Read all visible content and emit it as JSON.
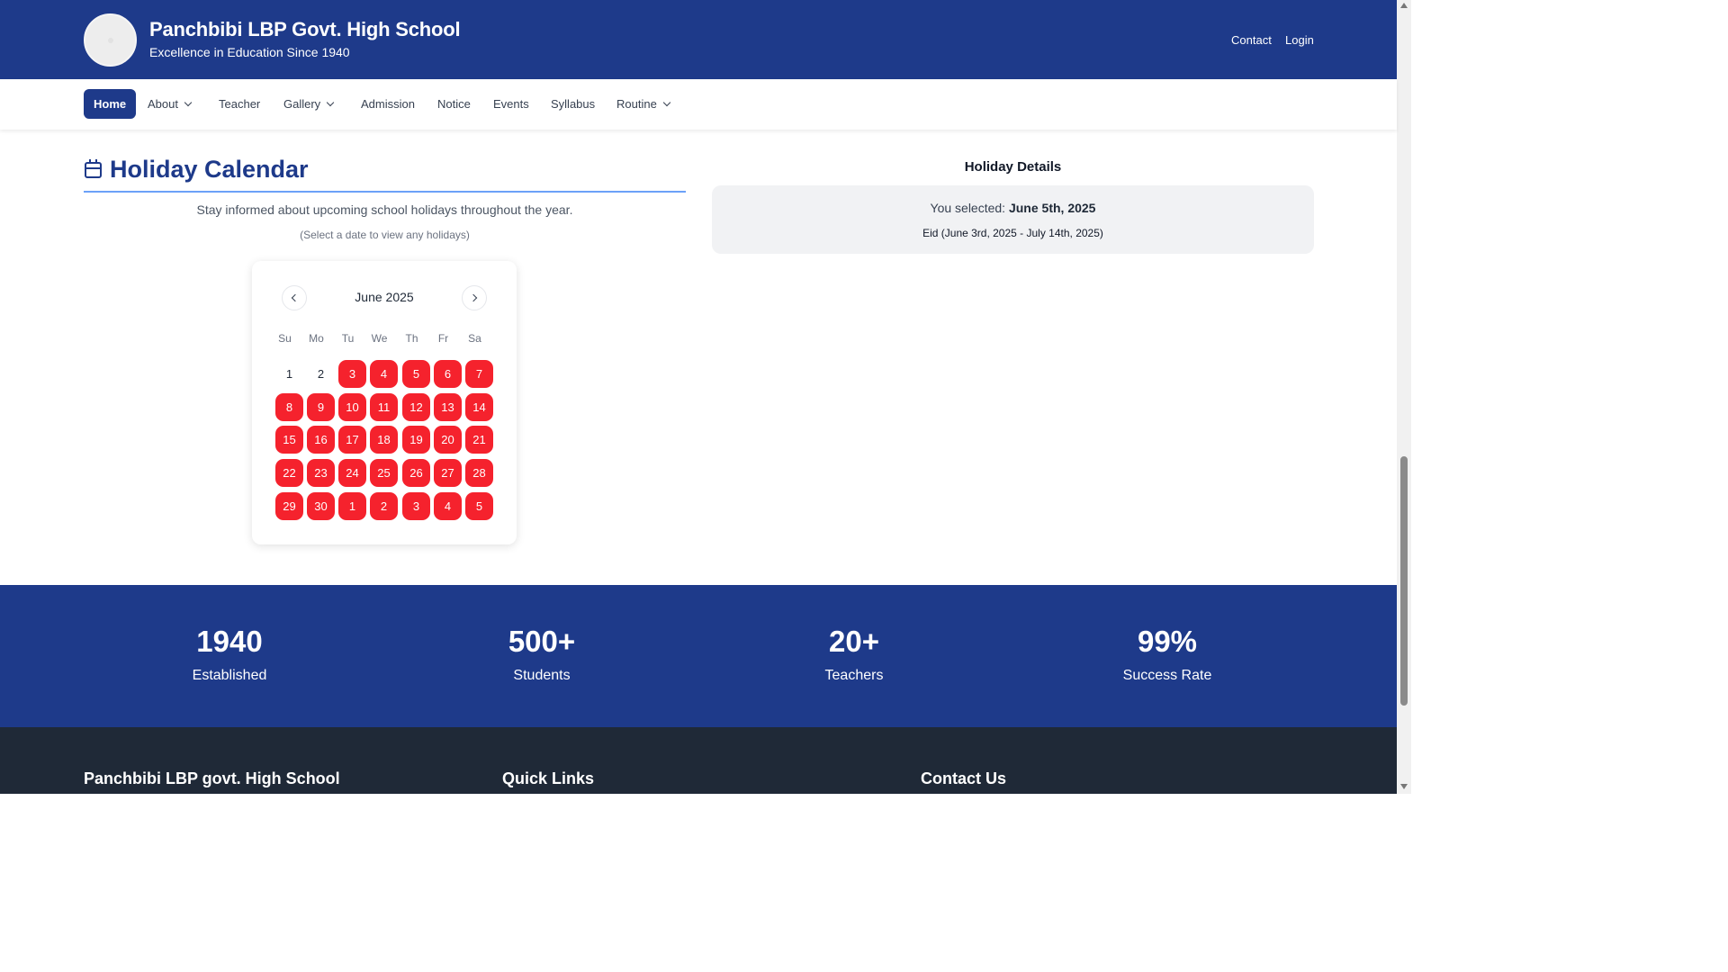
{
  "header": {
    "school_name": "Panchbibi LBP Govt. High School",
    "tagline": "Excellence in Education Since 1940",
    "links": {
      "contact": "Contact",
      "login": "Login"
    }
  },
  "nav": {
    "items": [
      {
        "label": "Home",
        "active": true,
        "dropdown": false
      },
      {
        "label": "About",
        "active": false,
        "dropdown": true
      },
      {
        "label": "Teacher",
        "active": false,
        "dropdown": false
      },
      {
        "label": "Gallery",
        "active": false,
        "dropdown": true
      },
      {
        "label": "Admission",
        "active": false,
        "dropdown": false
      },
      {
        "label": "Notice",
        "active": false,
        "dropdown": false
      },
      {
        "label": "Events",
        "active": false,
        "dropdown": false
      },
      {
        "label": "Syllabus",
        "active": false,
        "dropdown": false
      },
      {
        "label": "Routine",
        "active": false,
        "dropdown": true
      }
    ]
  },
  "calendar_section": {
    "title": "Holiday Calendar",
    "subtitle": "Stay informed about upcoming school holidays throughout the year.",
    "hint": "(Select a date to view any holidays)",
    "month_label": "June 2025",
    "weekdays": [
      "Su",
      "Mo",
      "Tu",
      "We",
      "Th",
      "Fr",
      "Sa"
    ],
    "weeks": [
      [
        {
          "d": "1",
          "h": false
        },
        {
          "d": "2",
          "h": false
        },
        {
          "d": "3",
          "h": true
        },
        {
          "d": "4",
          "h": true
        },
        {
          "d": "5",
          "h": true
        },
        {
          "d": "6",
          "h": true
        },
        {
          "d": "7",
          "h": true
        }
      ],
      [
        {
          "d": "8",
          "h": true
        },
        {
          "d": "9",
          "h": true
        },
        {
          "d": "10",
          "h": true
        },
        {
          "d": "11",
          "h": true
        },
        {
          "d": "12",
          "h": true
        },
        {
          "d": "13",
          "h": true
        },
        {
          "d": "14",
          "h": true
        }
      ],
      [
        {
          "d": "15",
          "h": true
        },
        {
          "d": "16",
          "h": true
        },
        {
          "d": "17",
          "h": true
        },
        {
          "d": "18",
          "h": true
        },
        {
          "d": "19",
          "h": true
        },
        {
          "d": "20",
          "h": true
        },
        {
          "d": "21",
          "h": true
        }
      ],
      [
        {
          "d": "22",
          "h": true
        },
        {
          "d": "23",
          "h": true
        },
        {
          "d": "24",
          "h": true
        },
        {
          "d": "25",
          "h": true
        },
        {
          "d": "26",
          "h": true
        },
        {
          "d": "27",
          "h": true
        },
        {
          "d": "28",
          "h": true
        }
      ],
      [
        {
          "d": "29",
          "h": true
        },
        {
          "d": "30",
          "h": true
        },
        {
          "d": "1",
          "h": true
        },
        {
          "d": "2",
          "h": true
        },
        {
          "d": "3",
          "h": true
        },
        {
          "d": "4",
          "h": true
        },
        {
          "d": "5",
          "h": true
        }
      ]
    ],
    "holiday_color": "#f5222d"
  },
  "details": {
    "title": "Holiday Details",
    "selected_prefix": "You selected: ",
    "selected_date": "June 5th, 2025",
    "holiday_text": "Eid (June 3rd, 2025 - July 14th, 2025)"
  },
  "stats": [
    {
      "value": "1940",
      "label": "Established"
    },
    {
      "value": "500+",
      "label": "Students"
    },
    {
      "value": "20+",
      "label": "Teachers"
    },
    {
      "value": "99%",
      "label": "Success Rate"
    }
  ],
  "footer": {
    "col1_title": "Panchbibi LBP govt. High School",
    "col2_title": "Quick Links",
    "col3_title": "Contact Us"
  },
  "colors": {
    "primary": "#1e3a8a",
    "footer_bg": "#1f2937",
    "holiday": "#f5222d",
    "accent_rule": "#3b82f6"
  }
}
